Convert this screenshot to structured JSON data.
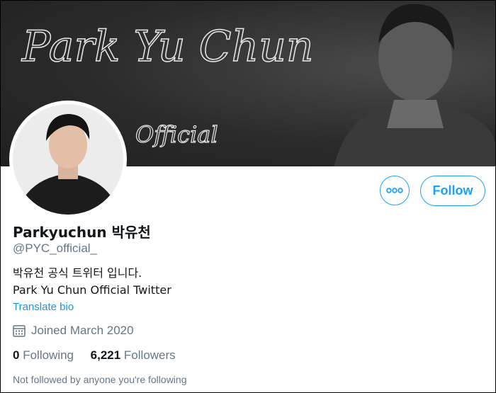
{
  "banner": {
    "script_title": "Park Yu Chun",
    "script_subtitle": "Official"
  },
  "profile": {
    "display_name": "Parkyuchun 박유천",
    "handle": "@PYC_official_",
    "bio_line1": "박유천 공식 트위터 입니다.",
    "bio_line2": "Park Yu Chun Official Twitter",
    "translate_label": "Translate bio",
    "joined": "Joined March 2020",
    "following_count": "0",
    "following_label": "Following",
    "followers_count": "6,221",
    "followers_label": "Followers",
    "not_followed_text": "Not followed by anyone you're following"
  },
  "actions": {
    "follow_label": "Follow",
    "more_icon": "more-icon"
  },
  "colors": {
    "accent": "#1da1f2",
    "link": "#1b95e0",
    "muted": "#657786",
    "text": "#14171a"
  }
}
